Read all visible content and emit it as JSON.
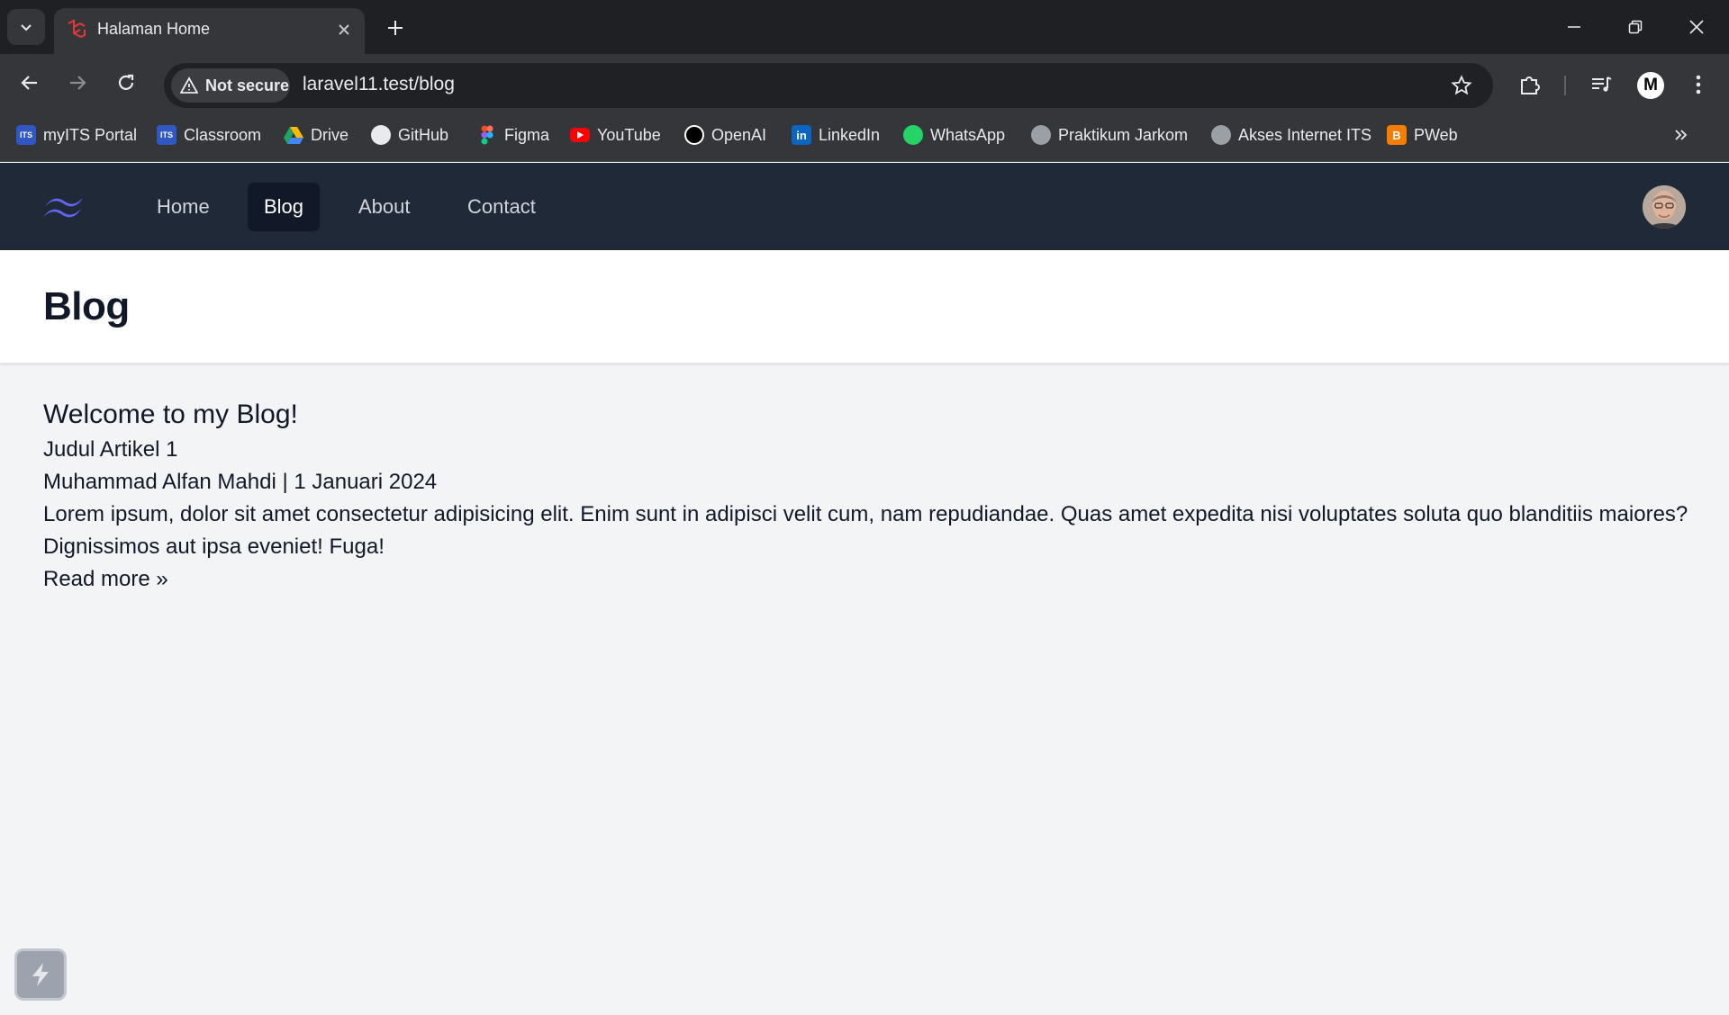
{
  "browser": {
    "tab_title": "Halaman Home",
    "security_label": "Not secure",
    "url": "laravel11.test/blog",
    "profile_initial": "M",
    "bookmarks": [
      {
        "label": "myITS Portal",
        "icon": "its-icon",
        "color": "#3157c4"
      },
      {
        "label": "Classroom",
        "icon": "its-icon",
        "color": "#3157c4"
      },
      {
        "label": "Drive",
        "icon": "drive-icon",
        "color": "#1fa463"
      },
      {
        "label": "GitHub",
        "icon": "github-icon",
        "color": "#e8eaed"
      },
      {
        "label": "Figma",
        "icon": "figma-icon",
        "color": "#a259ff"
      },
      {
        "label": "YouTube",
        "icon": "youtube-icon",
        "color": "#ff0000"
      },
      {
        "label": "OpenAI",
        "icon": "openai-icon",
        "color": "#ffffff"
      },
      {
        "label": "LinkedIn",
        "icon": "linkedin-icon",
        "color": "#0a66c2"
      },
      {
        "label": "WhatsApp",
        "icon": "whatsapp-icon",
        "color": "#25d366"
      },
      {
        "label": "Praktikum Jarkom",
        "icon": "globe-icon",
        "color": "#9aa0a6"
      },
      {
        "label": "Akses Internet ITS",
        "icon": "globe-icon",
        "color": "#9aa0a6"
      },
      {
        "label": "PWeb",
        "icon": "blogger-icon",
        "color": "#f57d00"
      }
    ]
  },
  "nav": {
    "items": [
      {
        "label": "Home",
        "active": false
      },
      {
        "label": "Blog",
        "active": true
      },
      {
        "label": "About",
        "active": false
      },
      {
        "label": "Contact",
        "active": false
      }
    ]
  },
  "header": {
    "title": "Blog"
  },
  "main": {
    "welcome": "Welcome to my Blog!",
    "post": {
      "title": "Judul Artikel 1",
      "meta": "Muhammad Alfan Mahdi | 1 Januari 2024",
      "body": "Lorem ipsum, dolor sit amet consectetur adipisicing elit. Enim sunt in adipisci velit cum, nam repudiandae. Quas amet expedita nisi voluptates soluta quo blanditiis maiores? Dignissimos aut ipsa eveniet! Fuga!",
      "read_more": "Read more »"
    }
  },
  "colors": {
    "navbar_bg": "#1f2937",
    "nav_active_bg": "#111827",
    "logo": "#6366f1",
    "page_bg": "#f3f4f6"
  }
}
